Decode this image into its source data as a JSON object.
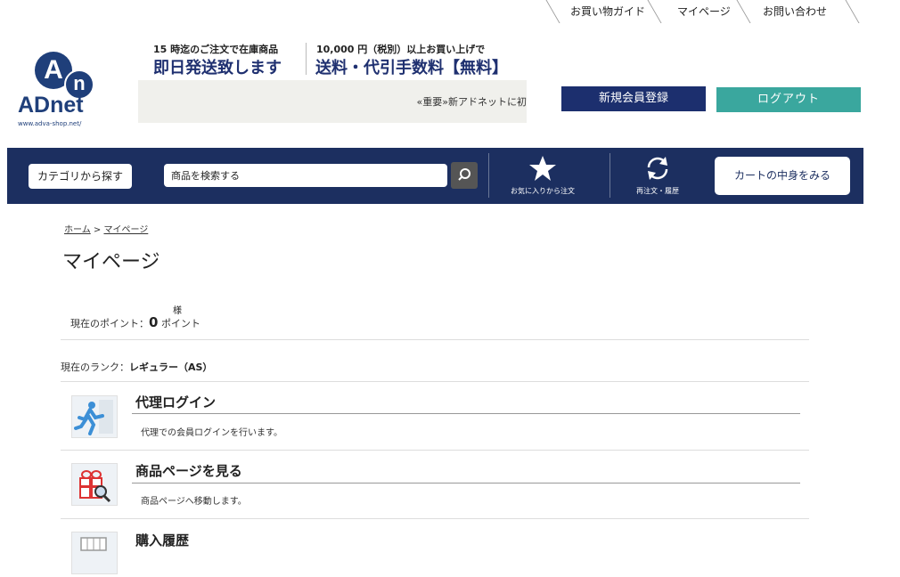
{
  "top_links": [
    "お買い物ガイド",
    "マイページ",
    "お問い合わせ"
  ],
  "logo": {
    "a": "A",
    "n": "n",
    "word": "ADnet",
    "url": "www.adva-shop.net/"
  },
  "promo": {
    "left_small": "15 時迄のご注文で在庫商品",
    "left_big": "即日発送致します",
    "right_small": "10,000 円（税別）以上お買い上げで",
    "right_big": "送料・代引手数料【無料】"
  },
  "news": "«重要»新アドネットに初",
  "buttons": {
    "register": "新規会員登録",
    "logout": "ログアウト"
  },
  "nav": {
    "category": "カテゴリから探す",
    "search_placeholder": "商品を検索する",
    "favorites": "お気に入りから注文",
    "reorder": "再注文・履歴",
    "cart": "カートの中身をみる"
  },
  "breadcrumb": {
    "home": "ホーム",
    "sep": ">",
    "current": "マイページ"
  },
  "page_title": "マイページ",
  "account": {
    "honorific": "様",
    "points_label": "現在のポイント：",
    "points_value": "0",
    "points_unit": "ポイント",
    "rank_label": "現在のランク：",
    "rank_value": "レギュラー（AS）"
  },
  "menu": [
    {
      "title": "代理ログイン",
      "desc": "代理での会員ログインを行います。",
      "icon": "runner-icon"
    },
    {
      "title": "商品ページを見る",
      "desc": "商品ページへ移動します。",
      "icon": "gift-magnifier-icon"
    },
    {
      "title": "購入履歴",
      "desc": "",
      "icon": "cart-history-icon"
    }
  ],
  "colors": {
    "navy": "#1c2f60",
    "register": "#1c2f6e",
    "logout": "#3aa79e",
    "logo": "#1f3f7a"
  }
}
